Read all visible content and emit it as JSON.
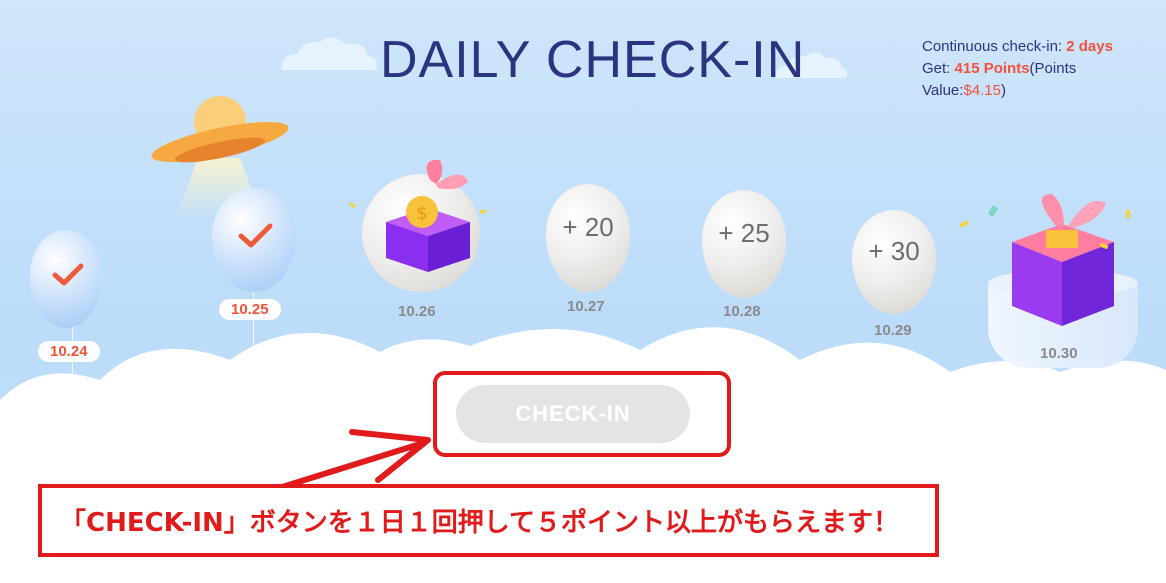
{
  "header": {
    "title": "DAILY CHECK-IN"
  },
  "info": {
    "continuous_label": "Continuous check-in: ",
    "continuous_value": "2 days",
    "get_label": "Get: ",
    "points_value": "415 Points",
    "points_value_label_open": "(Points",
    "value_label": "Value:",
    "value_amount": "$4.15",
    "value_close": ")"
  },
  "days": [
    {
      "date": "10.24",
      "status": "checked",
      "reward": ""
    },
    {
      "date": "10.25",
      "status": "checked",
      "reward": ""
    },
    {
      "date": "10.26",
      "status": "gift",
      "reward": ""
    },
    {
      "date": "10.27",
      "status": "pending",
      "reward": "+ 20"
    },
    {
      "date": "10.28",
      "status": "pending",
      "reward": "+ 25"
    },
    {
      "date": "10.29",
      "status": "pending",
      "reward": "+ 30"
    },
    {
      "date": "10.30",
      "status": "big-gift",
      "reward": ""
    }
  ],
  "checkin_button": {
    "label": "CHECK-IN",
    "enabled": false
  },
  "annotation": {
    "text": "「CHECK-IN」ボタンを１日１回押して５ポイント以上がもらえます！"
  },
  "colors": {
    "title": "#2a3480",
    "accent": "#f0523a",
    "annotation_red": "#e11b1b",
    "sky": "#bcdcf9",
    "button_disabled": "#e4e4e4"
  },
  "icons": {
    "check": "check-mark-icon",
    "coin": "coin-icon",
    "ufo": "ufo-icon",
    "gift": "gift-box-icon"
  }
}
